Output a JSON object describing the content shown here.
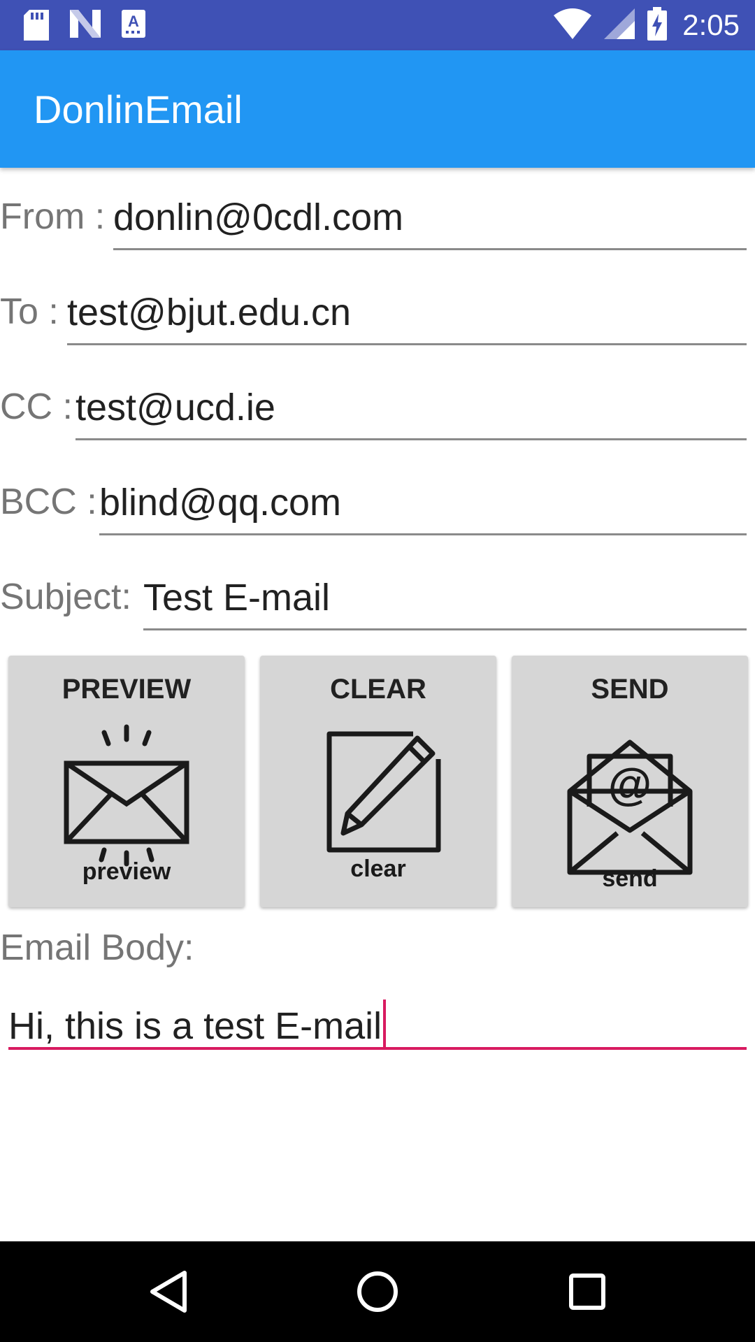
{
  "status_bar": {
    "time": "2:05",
    "icons": [
      "sd-card-icon",
      "n-notification-icon",
      "a-notification-icon",
      "wifi-icon",
      "signal-icon",
      "battery-charging-icon"
    ]
  },
  "app": {
    "title": "DonlinEmail"
  },
  "form": {
    "from": {
      "label": "From :",
      "value": "donlin@0cdl.com"
    },
    "to": {
      "label": "To :",
      "value": "test@bjut.edu.cn"
    },
    "cc": {
      "label": "CC :",
      "value": "test@ucd.ie"
    },
    "bcc": {
      "label": "BCC :",
      "value": "blind@qq.com"
    },
    "subject": {
      "label": "Subject:",
      "value": "Test E-mail"
    }
  },
  "buttons": {
    "preview": {
      "label": "PREVIEW",
      "caption": "preview",
      "icon": "envelope-icon"
    },
    "clear": {
      "label": "CLEAR",
      "caption": "clear",
      "icon": "pencil-icon"
    },
    "send": {
      "label": "SEND",
      "caption": "send",
      "icon": "open-envelope-at-icon"
    }
  },
  "email_body": {
    "label": "Email Body:",
    "value": "Hi, this is a test E-mail"
  },
  "colors": {
    "status_bar": "#3f51b5",
    "app_bar": "#2196f3",
    "accent": "#d81b60",
    "button_bg": "#d6d6d6"
  },
  "nav_bar": {
    "icons": [
      "back-icon",
      "home-icon",
      "recents-icon"
    ]
  }
}
